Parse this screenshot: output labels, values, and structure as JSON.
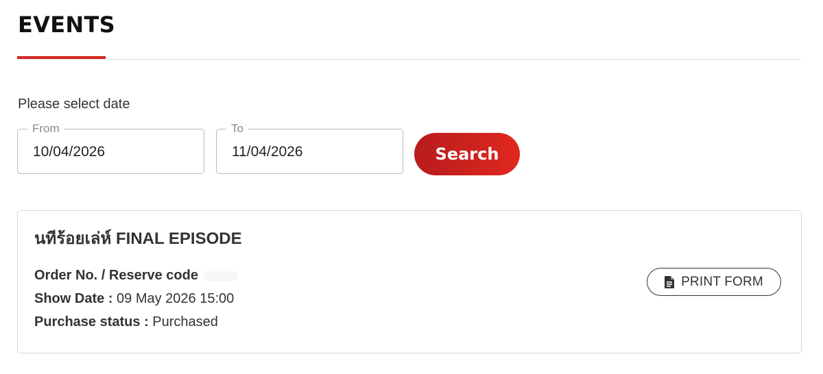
{
  "header": {
    "title": "EVENTS"
  },
  "filter": {
    "prompt": "Please select date",
    "from": {
      "legend": "From",
      "value": "10/04/2026"
    },
    "to": {
      "legend": "To",
      "value": "11/04/2026"
    },
    "search_label": "Search"
  },
  "event": {
    "title": "นทีร้อยเล่ห์ FINAL EPISODE",
    "order_label": "Order No. / Reserve code",
    "order_value": "",
    "show_date_label": "Show Date :",
    "show_date_value": "09 May 2026 15:00",
    "status_label": "Purchase status :",
    "status_value": "Purchased",
    "print_label": "PRINT FORM",
    "print_icon": "document-icon"
  },
  "colors": {
    "accent": "#d3261f",
    "button_gradient_start": "#b71c1c",
    "button_gradient_end": "#e0281f",
    "border": "#b9b9b9",
    "text": "#333333"
  }
}
